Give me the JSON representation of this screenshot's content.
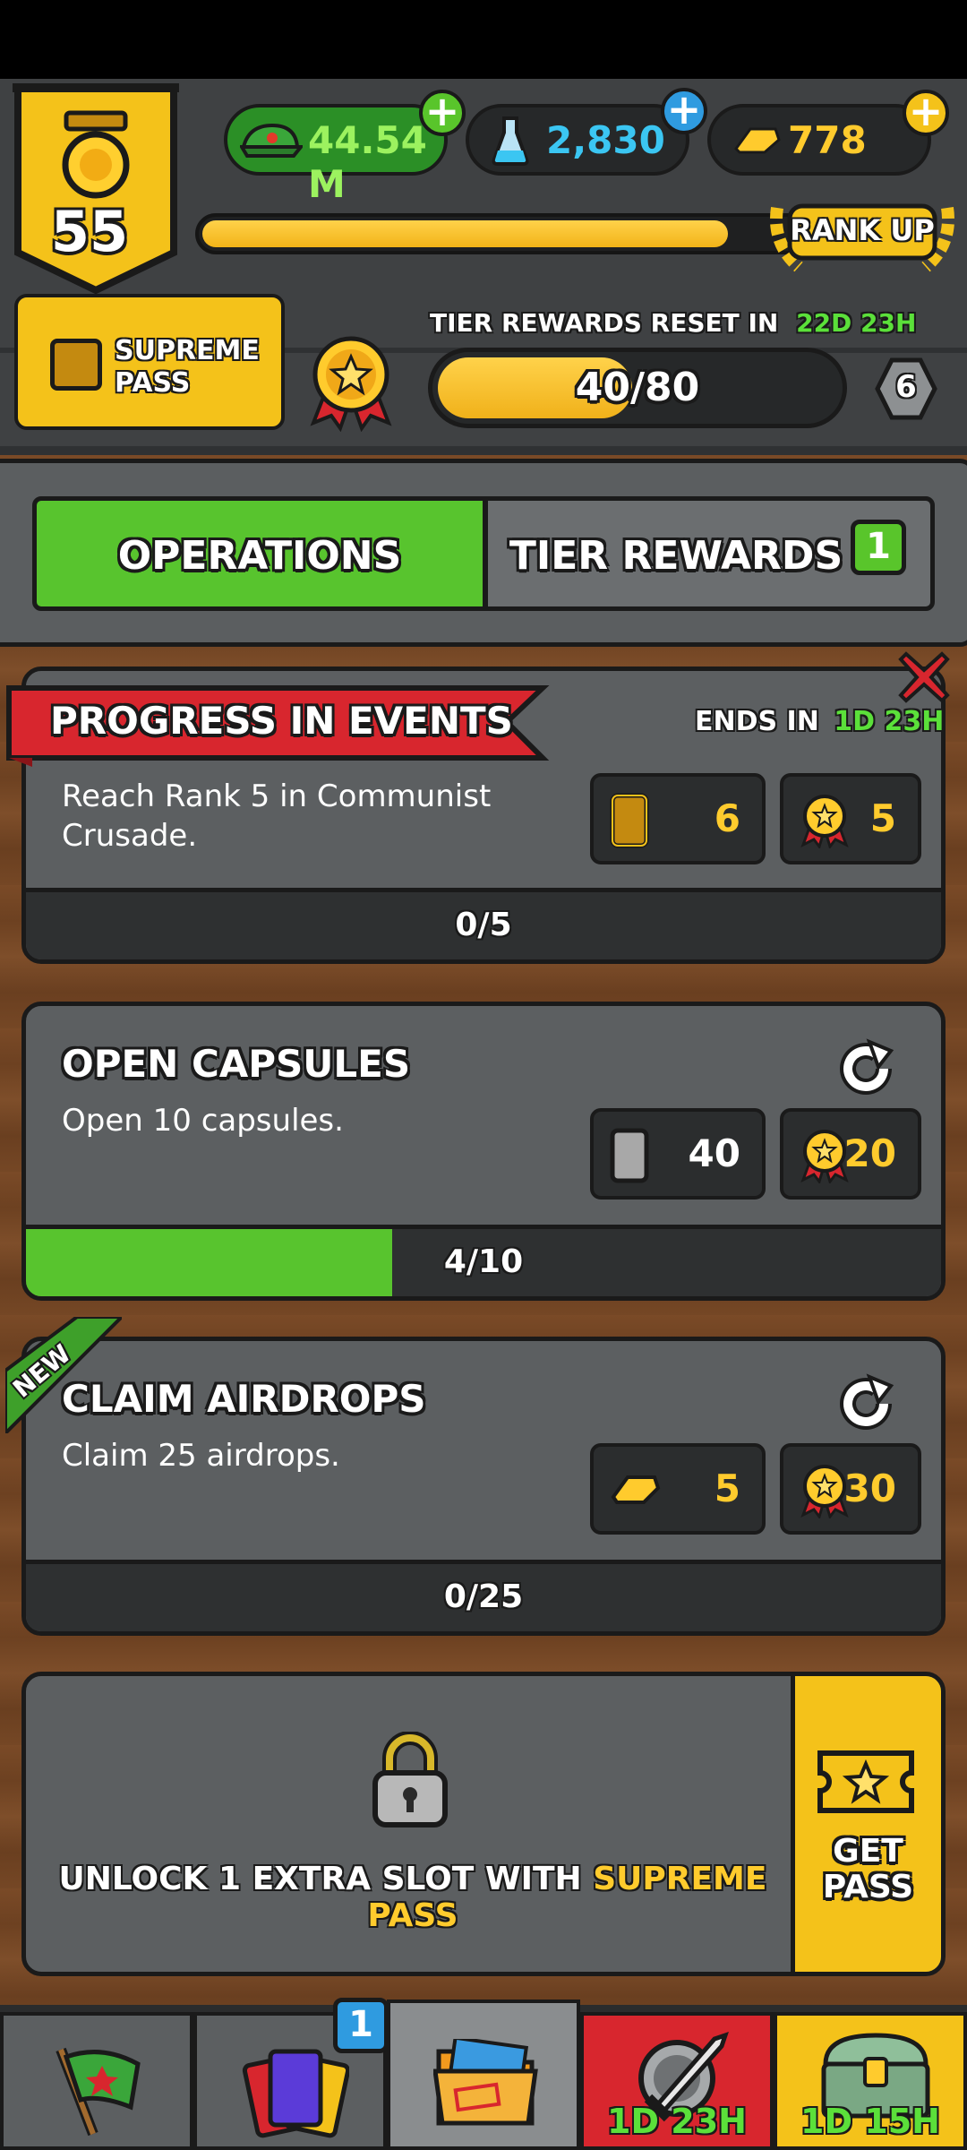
{
  "header": {
    "rank_level": "55",
    "currencies": [
      {
        "name": "cash",
        "value": "44.54 M"
      },
      {
        "name": "research",
        "value": "2,830"
      },
      {
        "name": "gold",
        "value": "778"
      }
    ],
    "xp_progress": 0.86,
    "rank_up_label": "RANK UP",
    "supreme_pass_label": "SUPREME PASS",
    "tier_reset_label": "TIER REWARDS RESET IN",
    "tier_reset_time": "22D 23H",
    "tier_progress": {
      "current": 40,
      "max": 80,
      "text": "40/80"
    },
    "tier_level": "6"
  },
  "tabs": {
    "operations_label": "OPERATIONS",
    "tier_rewards_label": "TIER REWARDS",
    "tier_rewards_badge": "1"
  },
  "operations": [
    {
      "title": "PROGRESS IN EVENTS",
      "ends_label": "ENDS IN",
      "ends_time": "1D 23H",
      "description": "Reach Rank 5 in Communist Crusade.",
      "rewards": [
        {
          "icon": "gold-card-icon",
          "value": "6"
        },
        {
          "icon": "medal-icon",
          "value": "5"
        }
      ],
      "progress_text": "0/5",
      "progress": 0
    },
    {
      "title": "OPEN CAPSULES",
      "description": "Open 10 capsules.",
      "rewards": [
        {
          "icon": "silver-card-icon",
          "value": "40"
        },
        {
          "icon": "medal-icon",
          "value": "20"
        }
      ],
      "progress_text": "4/10",
      "progress": 0.4
    },
    {
      "title": "CLAIM AIRDROPS",
      "badge": "NEW",
      "description": "Claim 25 airdrops.",
      "rewards": [
        {
          "icon": "gold-bar-icon",
          "value": "5"
        },
        {
          "icon": "medal-icon",
          "value": "30"
        }
      ],
      "progress_text": "0/25",
      "progress": 0
    }
  ],
  "unlock": {
    "text_prefix": "UNLOCK 1 EXTRA SLOT WITH",
    "text_highlight": "SUPREME PASS",
    "get_pass_label": "GET PASS"
  },
  "bottom_nav": {
    "cards_badge": "1",
    "battle_timer": "1D 23H",
    "chest_timer": "1D 15H"
  },
  "colors": {
    "green": "#58c42e",
    "gold": "#f4c21a",
    "red": "#d8262e",
    "cyan": "#3bc6f2"
  }
}
